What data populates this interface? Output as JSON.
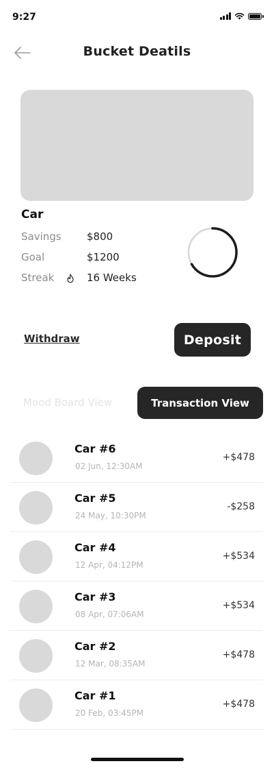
{
  "status_bar": {
    "time": "9:27",
    "battery_level": 1.0
  },
  "header": {
    "title": "Bucket Deatils",
    "back_icon": "arrow-left-icon"
  },
  "bucket": {
    "name": "Car",
    "savings_label": "Savings",
    "savings_value": "$800",
    "goal_label": "Goal",
    "goal_value": "$1200",
    "streak_label": "Streak",
    "streak_icon": "fire-icon",
    "streak_value": "16 Weeks",
    "progress": 0.667
  },
  "actions": {
    "withdraw_label": "Withdraw",
    "deposit_label": "Deposit"
  },
  "view_toggle": {
    "mood_board_label": "Mood Board View",
    "transaction_label": "Transaction View"
  },
  "transactions": [
    {
      "title": "Car #6",
      "date": "02 Jun, 12:30AM",
      "amount": "+$478"
    },
    {
      "title": "Car #5",
      "date": "24 May, 10:30PM",
      "amount": "-$258"
    },
    {
      "title": "Car #4",
      "date": "12 Apr, 04:12PM",
      "amount": "+$534"
    },
    {
      "title": "Car #3",
      "date": "08 Apr, 07:06AM",
      "amount": "+$534"
    },
    {
      "title": "Car #2",
      "date": "12 Mar, 08:35AM",
      "amount": "+$478"
    },
    {
      "title": "Car #1",
      "date": "20 Feb, 03:45PM",
      "amount": "+$478"
    }
  ],
  "colors": {
    "primary_dark": "#262626",
    "placeholder_gray": "#d9d9d9",
    "muted_text": "#8c8c8c"
  }
}
